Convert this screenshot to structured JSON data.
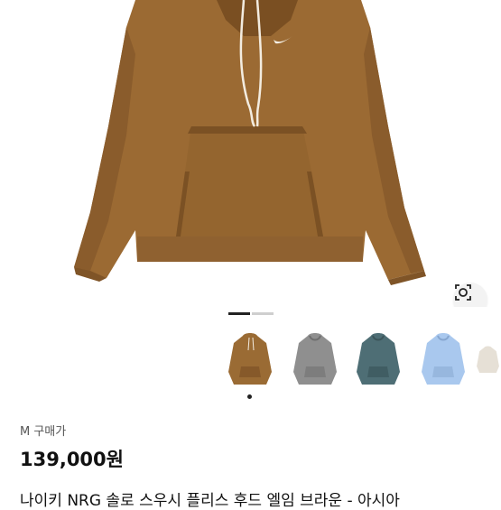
{
  "product": {
    "price_label": "M 구매가",
    "price": "139,000원",
    "title": "나이키 NRG 솔로 스우시 플리스 후드 엘임 브라운 - 아시아"
  },
  "gallery": {
    "pages": 2,
    "active_page": 1,
    "thumbnails": [
      {
        "name": "brown",
        "color": "#9a6b34"
      },
      {
        "name": "grey",
        "color": "#8c8c8c"
      },
      {
        "name": "slate",
        "color": "#4e6e75"
      },
      {
        "name": "light-blue",
        "color": "#a9c8ee"
      },
      {
        "name": "cream",
        "color": "#e6e0d6"
      }
    ],
    "selected_thumbnail": 0
  },
  "colors": {
    "hoodie_main": "#9b6a33",
    "hoodie_shadow": "#86582a",
    "hoodie_light": "#ad7b42"
  }
}
